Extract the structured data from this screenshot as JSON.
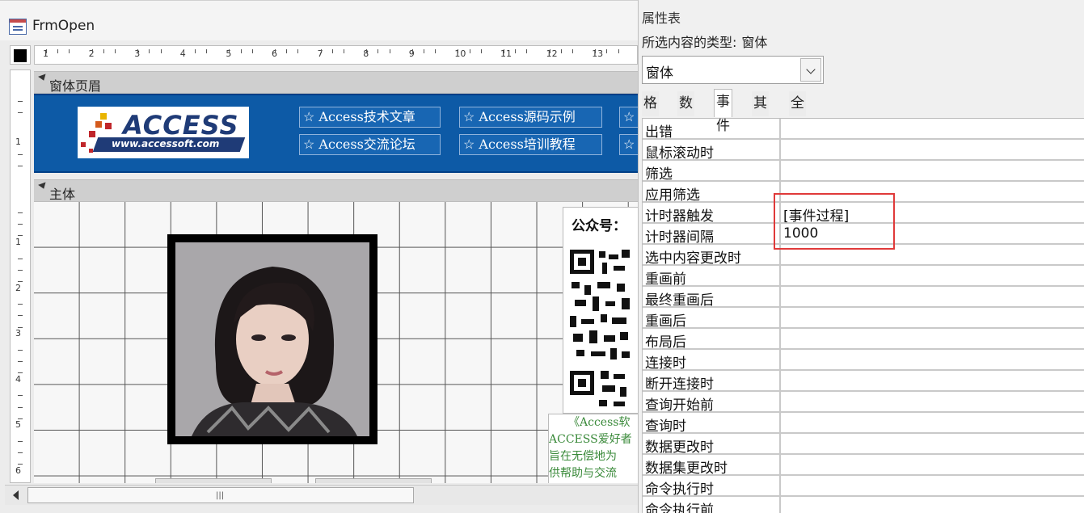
{
  "document": {
    "title": "FrmOpen"
  },
  "ruler": {
    "h_numbers": [
      "1",
      "2",
      "3",
      "4",
      "5",
      "6",
      "7",
      "8",
      "9",
      "10",
      "11",
      "12",
      "13"
    ],
    "v_numbers": [
      "1",
      "2",
      "3",
      "4",
      "5",
      "6"
    ]
  },
  "sections": {
    "header_label": "窗体页眉",
    "detail_label": "主体"
  },
  "header": {
    "logo_text": "ACCESS",
    "logo_url": "www.accessoft.com",
    "nav_buttons": [
      {
        "label": "☆ Access技术文章"
      },
      {
        "label": "☆ Access源码示例"
      },
      {
        "label": "☆"
      },
      {
        "label": "☆ Access交流论坛"
      },
      {
        "label": "☆ Access培训教程"
      },
      {
        "label": "☆"
      }
    ]
  },
  "detail": {
    "qr_caption": "公众号：",
    "intro_lines": [
      "《Access软",
      "ACCESS爱好者",
      "旨在无偿地为",
      "供帮助与交流"
    ]
  },
  "property_sheet": {
    "title": "属性表",
    "selection_type_label": "所选内容的类型:",
    "selection_type_value": "窗体",
    "object_select_value": "窗体",
    "tabs": [
      "格式",
      "数据",
      "事件",
      "其他",
      "全部"
    ],
    "active_tab": "事件",
    "rows": [
      {
        "name": "出错",
        "value": ""
      },
      {
        "name": "鼠标滚动时",
        "value": ""
      },
      {
        "name": "筛选",
        "value": ""
      },
      {
        "name": "应用筛选",
        "value": ""
      },
      {
        "name": "计时器触发",
        "value": "[事件过程]"
      },
      {
        "name": "计时器间隔",
        "value": "1000"
      },
      {
        "name": "选中内容更改时",
        "value": ""
      },
      {
        "name": "重画前",
        "value": ""
      },
      {
        "name": "最终重画后",
        "value": ""
      },
      {
        "name": "重画后",
        "value": ""
      },
      {
        "name": "布局后",
        "value": ""
      },
      {
        "name": "连接时",
        "value": ""
      },
      {
        "name": "断开连接时",
        "value": ""
      },
      {
        "name": "查询开始前",
        "value": ""
      },
      {
        "name": "查询时",
        "value": ""
      },
      {
        "name": "数据更改时",
        "value": ""
      },
      {
        "name": "数据集更改时",
        "value": ""
      },
      {
        "name": "命令执行时",
        "value": ""
      },
      {
        "name": "命令执行前",
        "value": ""
      }
    ]
  },
  "colors": {
    "header_blue": "#0d5aa6",
    "highlight_red": "#e03a3a",
    "intro_green": "#3a8a3a"
  }
}
